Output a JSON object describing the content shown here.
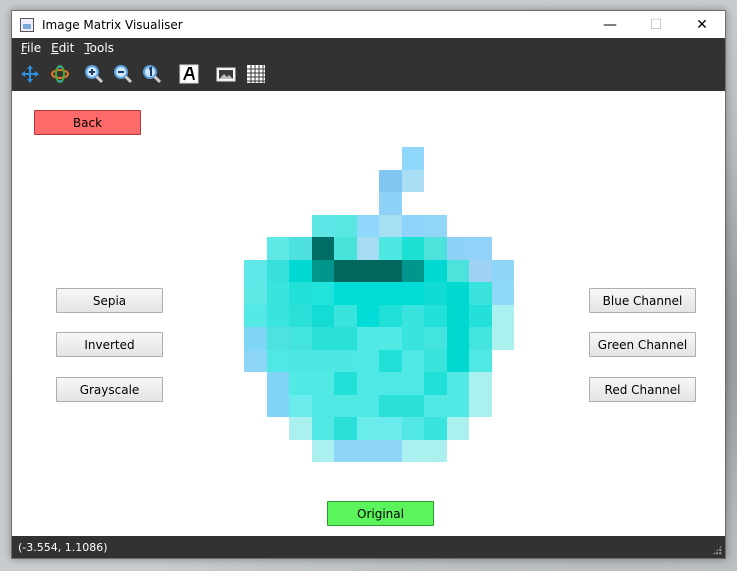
{
  "window": {
    "title": "Image Matrix Visualiser",
    "controls": {
      "minimize": "—",
      "maximize": "☐",
      "close": "✕"
    }
  },
  "menubar": {
    "items": [
      {
        "label": "File",
        "mnemonic": "F",
        "rest": "ile"
      },
      {
        "label": "Edit",
        "mnemonic": "E",
        "rest": "dit"
      },
      {
        "label": "Tools",
        "mnemonic": "T",
        "rest": "ools"
      }
    ]
  },
  "toolbar": {
    "tools": [
      {
        "icon": "pan-arrows-icon",
        "color": "#2f8fe0"
      },
      {
        "icon": "orbit-arrows-icon",
        "color": "#e8722a"
      },
      {
        "icon": "zoom-in-icon",
        "color": "#5aa0e0"
      },
      {
        "icon": "zoom-out-icon",
        "color": "#5aa0e0"
      },
      {
        "icon": "zoom-reset-icon",
        "color": "#5aa0e0"
      },
      {
        "icon": "text-annotation-icon",
        "color": "#ffffff"
      },
      {
        "icon": "image-view-icon",
        "color": "#ffffff"
      },
      {
        "icon": "grid-view-icon",
        "color": "#ffffff"
      }
    ]
  },
  "buttons": {
    "back": "Back",
    "sepia": "Sepia",
    "inverted": "Inverted",
    "grayscale": "Grayscale",
    "blue_channel": "Blue Channel",
    "green_channel": "Green Channel",
    "red_channel": "Red Channel",
    "original": "Original"
  },
  "colors": {
    "back_button": "#ff6b6b",
    "original_button": "#5cf45c",
    "menubar_bg": "#323232"
  },
  "pixel_matrix": {
    "rows": [
      [
        "",
        "",
        "",
        "",
        "",
        "",
        "",
        "#8fd8fb",
        "",
        "",
        "",
        ""
      ],
      [
        "",
        "",
        "",
        "",
        "",
        "",
        "#7fc7f2",
        "#a9def4",
        "",
        "",
        "",
        ""
      ],
      [
        "",
        "",
        "",
        "",
        "",
        "",
        "#8fd2f8",
        "",
        "",
        "",
        "",
        ""
      ],
      [
        "",
        "",
        "",
        "#5ee6e6",
        "#5ae6e3",
        "#8fd8fb",
        "#a6def4",
        "#8fd3f8",
        "#92d6f7",
        "",
        "",
        ""
      ],
      [
        "",
        "#5ee8e6",
        "#4ee0de",
        "#006c66",
        "#48e4dc",
        "#a5dcf4",
        "#4ee8e2",
        "#1de0d4",
        "#4ee2dc",
        "#8ed2f8",
        "#92d2f8",
        ""
      ],
      [
        "#5ee8e8",
        "#38e0dc",
        "#00d8d2",
        "#00968c",
        "#00665e",
        "#00665e",
        "#00665e",
        "#00968c",
        "#00d8d2",
        "#4ee2dc",
        "#9ed2f4",
        "#8ed6f8"
      ],
      [
        "#5ee8e6",
        "#38e4de",
        "#20e0d8",
        "#20e4dc",
        "#00dcd6",
        "#00dcd6",
        "#00dcd6",
        "#00dcd6",
        "#10dcd4",
        "#00d8d0",
        "#3ae4dc",
        "#8ed8f8"
      ],
      [
        "#52e8e4",
        "#3ae4de",
        "#2ae0d8",
        "#14dcd4",
        "#3ae4de",
        "#00dcd6",
        "#20e0d8",
        "#3ae4de",
        "#20e0d8",
        "#00d8d0",
        "#24e0d8",
        "#aaf0ee"
      ],
      [
        "#7ed6f4",
        "#4ee2de",
        "#44e4de",
        "#2ae0d8",
        "#2ae0d8",
        "#52e8e4",
        "#52e8e4",
        "#3ae4de",
        "#44e4de",
        "#00d8d0",
        "#44e4de",
        "#aaf0ee"
      ],
      [
        "#8ed6f8",
        "#50e8e4",
        "#4ee8e4",
        "#4ee8e4",
        "#4ee8e4",
        "#50e8e4",
        "#20e0d8",
        "#50e8e4",
        "#3ae4de",
        "#00d8d0",
        "#50e8e4",
        ""
      ],
      [
        "",
        "#82d4f6",
        "#52e8e4",
        "#52e8e4",
        "#20e0d8",
        "#50e8e4",
        "#50e8e4",
        "#50e8e4",
        "#20e0d8",
        "#52e8e4",
        "#aaf0ee",
        ""
      ],
      [
        "",
        "#82d4f6",
        "#6aecec",
        "#52e8e4",
        "#52e8e4",
        "#52e8e4",
        "#2ae0d8",
        "#2ae0d8",
        "#52e8e4",
        "#52e8e4",
        "#aaf0ee",
        ""
      ],
      [
        "",
        "",
        "#aaf0ee",
        "#52e8e4",
        "#2ae0d8",
        "#6aecec",
        "#6aecec",
        "#52e8e4",
        "#3ae4de",
        "#aaf0ee",
        "",
        ""
      ],
      [
        "",
        "",
        "",
        "#aaf0ee",
        "#8ed6f8",
        "#8ed6f8",
        "#8ed6f8",
        "#aaf0ee",
        "#aaf0ee",
        "",
        "",
        ""
      ]
    ]
  },
  "status": {
    "coords": "(-3.554, 1.1086)"
  }
}
